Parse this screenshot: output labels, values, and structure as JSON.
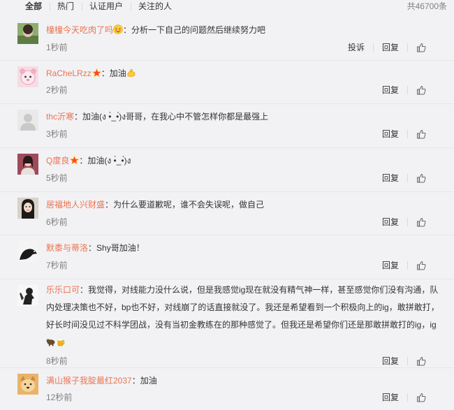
{
  "tabs": [
    "全部",
    "热门",
    "认证用户",
    "关注的人"
  ],
  "total": "共46700条",
  "actions": {
    "report": "投诉",
    "reply": "回复"
  },
  "comments": [
    {
      "user": "橦橦今天吃肉了吗",
      "text": "：分析一下自己的问题然后继续努力吧",
      "time": "1秒前"
    },
    {
      "user": "RaCheLRzz",
      "text": "：加油",
      "time": "2秒前"
    },
    {
      "user": "thc沂寒",
      "text": "：加油(ง •̀_•́)ง哥哥，在我心中不管怎样你都是最强上",
      "time": "3秒前"
    },
    {
      "user": "Q度良",
      "text": "：加油(ง •̀_•́)ง",
      "time": "5秒前"
    },
    {
      "user": "居福地人兴财盛",
      "text": "：为什么要道歉呢，谁不会失误呢，做自己",
      "time": "6秒前"
    },
    {
      "user": "默黍与蒂洛",
      "text": "：Shy哥加油！",
      "time": "7秒前"
    },
    {
      "user": "乐乐口可",
      "text": "：我觉得，对线能力没什么说，但是我感觉ig现在就没有精气神一样，甚至感觉你们没有沟通，队内处理决策也不好，bp也不好，对线崩了的话直接就没了。我还是希望看到一个积极向上的ig，敢拼敢打，好长时间没见过不科学团战，没有当初金教练在的那种感觉了。但我还是希望你们还是那敢拼敢打的ig，ig",
      "time": "8秒前"
    },
    {
      "user": "满山猴子我腚最红2037",
      "text": "：加油",
      "time": "12秒前"
    }
  ],
  "colors": {
    "username": "#eb7350",
    "vip_star": "#f43",
    "time": "#808080",
    "divider": "#e6e6e6",
    "background": "#f2f2f5"
  },
  "icons": {
    "like": "thumbs-up-icon",
    "vip": "vip-star-icon"
  }
}
